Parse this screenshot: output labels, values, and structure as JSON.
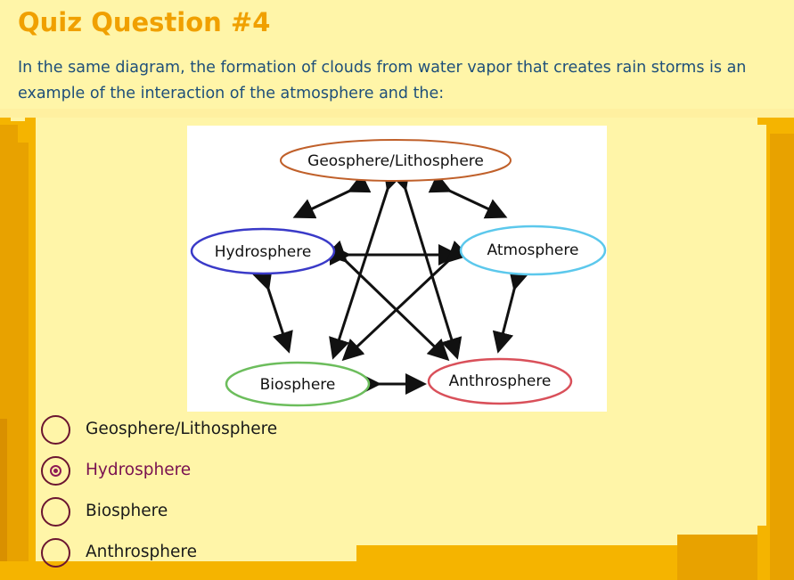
{
  "quiz": {
    "title": "Quiz Question #4",
    "question": "In the same diagram, the formation of clouds from water vapor that creates rain storms is an example of the interaction of the atmosphere and the:"
  },
  "diagram": {
    "nodes": [
      {
        "id": "geosphere",
        "label": "Geosphere/Lithosphere",
        "color": "#c0602a"
      },
      {
        "id": "hydrosphere",
        "label": "Hydrosphere",
        "color": "#3a3ac8"
      },
      {
        "id": "atmosphere",
        "label": "Atmosphere",
        "color": "#5cc8ec"
      },
      {
        "id": "biosphere",
        "label": "Biosphere",
        "color": "#6cbd5c"
      },
      {
        "id": "anthrosphere",
        "label": "Anthrosphere",
        "color": "#d9505a"
      }
    ],
    "links": [
      [
        "geosphere",
        "hydrosphere"
      ],
      [
        "geosphere",
        "atmosphere"
      ],
      [
        "geosphere",
        "biosphere"
      ],
      [
        "geosphere",
        "anthrosphere"
      ],
      [
        "hydrosphere",
        "atmosphere"
      ],
      [
        "hydrosphere",
        "biosphere"
      ],
      [
        "hydrosphere",
        "anthrosphere"
      ],
      [
        "atmosphere",
        "biosphere"
      ],
      [
        "atmosphere",
        "anthrosphere"
      ],
      [
        "biosphere",
        "anthrosphere"
      ]
    ]
  },
  "options": [
    {
      "label": "Geosphere/Lithosphere",
      "selected": false
    },
    {
      "label": "Hydrosphere",
      "selected": true
    },
    {
      "label": "Biosphere",
      "selected": false
    },
    {
      "label": "Anthrosphere",
      "selected": false
    }
  ],
  "colors": {
    "title": "#f0a000",
    "question_text": "#1e4f7a",
    "background": "#fff5a8",
    "border_orange": "#f5a800",
    "radio": "#6b1530"
  }
}
